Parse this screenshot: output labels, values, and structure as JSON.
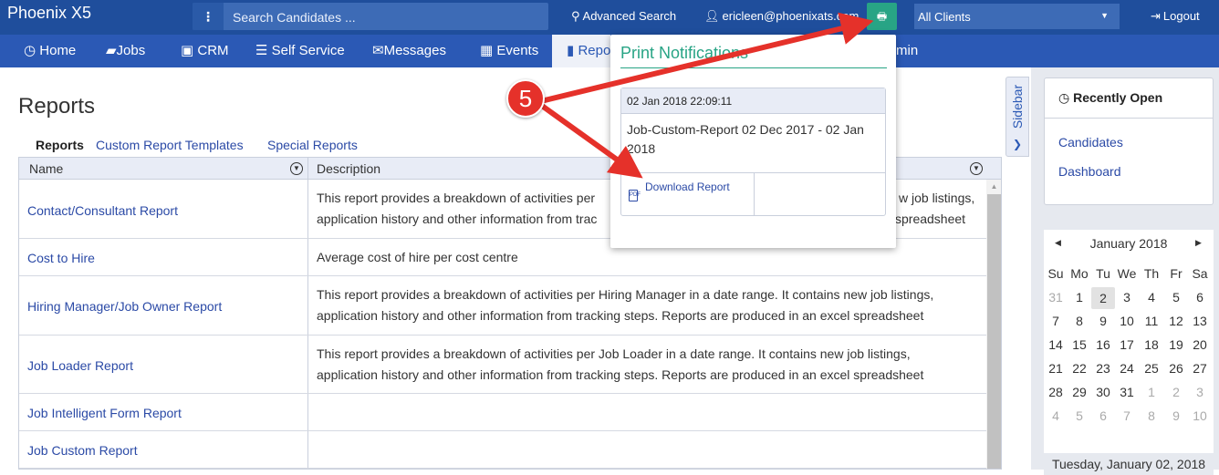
{
  "app": {
    "title": "Phoenix X5"
  },
  "topbar": {
    "search_placeholder": "Search Candidates ...",
    "advanced_search": "Advanced Search",
    "user_email": "ericleen@phoenixats.com",
    "client_select": "All Clients",
    "logout": "Logout"
  },
  "nav": {
    "home": "Home",
    "jobs": "Jobs",
    "crm": "CRM",
    "self_service": "Self Service",
    "messages": "Messages",
    "events": "Events",
    "reports_partial": "Repo",
    "admin_partial": "min"
  },
  "reports": {
    "title": "Reports",
    "subtabs": {
      "reports": "Reports",
      "custom_templates": "Custom Report Templates",
      "special_reports": "Special Reports"
    },
    "columns": {
      "name": "Name",
      "description": "Description"
    },
    "rows": [
      {
        "name": "Contact/Consultant Report",
        "desc_line1": "This report provides a breakdown of activities per",
        "desc_line1_tail": "w job listings,",
        "desc_line2": "application history and other information from trac",
        "desc_line2_tail": "spreadsheet"
      },
      {
        "name": "Cost to Hire",
        "desc_line1": "Average cost of hire per cost centre"
      },
      {
        "name": "Hiring Manager/Job Owner Report",
        "desc_line1": "This report provides a breakdown of activities per Hiring Manager in a date range. It contains new job listings,",
        "desc_line2": "application history and other information from tracking steps. Reports are produced in an excel spreadsheet"
      },
      {
        "name": "Job Loader Report",
        "desc_line1": "This report provides a breakdown of activities per Job Loader in a date range. It contains new job listings,",
        "desc_line2": "application history and other information from tracking steps. Reports are produced in an excel spreadsheet"
      },
      {
        "name": "Job Intelligent Form Report"
      },
      {
        "name": "Job Custom Report"
      }
    ]
  },
  "sidebar_tab": {
    "label": "Sidebar"
  },
  "recently_open": {
    "title": "Recently Open",
    "items": [
      "Candidates",
      "Dashboard"
    ]
  },
  "calendar": {
    "month": "January 2018",
    "weekdays": [
      "Su",
      "Mo",
      "Tu",
      "We",
      "Th",
      "Fr",
      "Sa"
    ],
    "weeks": [
      [
        "31",
        "1",
        "2",
        "3",
        "4",
        "5",
        "6"
      ],
      [
        "7",
        "8",
        "9",
        "10",
        "11",
        "12",
        "13"
      ],
      [
        "14",
        "15",
        "16",
        "17",
        "18",
        "19",
        "20"
      ],
      [
        "21",
        "22",
        "23",
        "24",
        "25",
        "26",
        "27"
      ],
      [
        "28",
        "29",
        "30",
        "31",
        "1",
        "2",
        "3"
      ],
      [
        "4",
        "5",
        "6",
        "7",
        "8",
        "9",
        "10"
      ]
    ],
    "footer": "Tuesday, January 02, 2018"
  },
  "print_notifications": {
    "title": "Print Notifications",
    "timestamp": "02 Jan 2018 22:09:11",
    "report_name": "Job-Custom-Report 02 Dec 2017 - 02 Jan 2018",
    "download_label": "Download Report"
  },
  "annotation": {
    "step": "5",
    "color": "#e5312a"
  }
}
